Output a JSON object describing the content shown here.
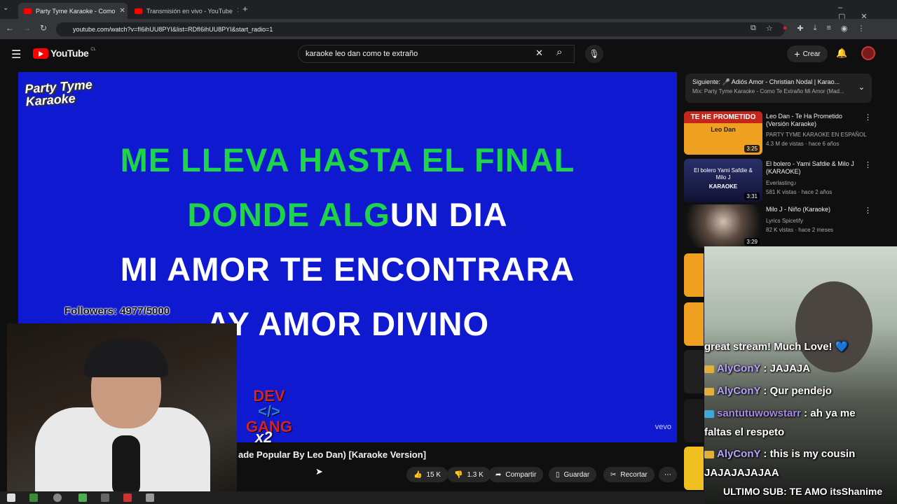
{
  "browser": {
    "tabs": [
      {
        "title": "Party Tyme Karaoke - Como",
        "active": true
      },
      {
        "title": "Transmisión en vivo - YouTube",
        "active": false
      }
    ],
    "url": "youtube.com/watch?v=fI6ihUU8PYI&list=RDfI6ihUU8PYI&start_radio=1"
  },
  "youtube": {
    "logo": "YouTube",
    "region": "CL",
    "search_query": "karaoke leo dan como te extraño",
    "create_label": "Crear"
  },
  "player": {
    "brand": "Party Tyme Karaoke",
    "lyrics": {
      "line1": "ME LLEVA HASTA EL FINAL",
      "line2_sung": "DONDE ALG",
      "line2_rest": "UN DIA",
      "line3": "MI AMOR TE ENCONTRARA",
      "line4": "AY AMOR DIVINO"
    },
    "vevo": "vevo"
  },
  "overlay": {
    "followers": "Followers: 4977/5000",
    "devgang_top": "DEV",
    "devgang_mid": "</>",
    "devgang_bottom": "GANG",
    "devgang_multiplier": "x2",
    "ultimo_sub": "ULTIMO SUB: TE AMO itsShanime"
  },
  "video": {
    "title": "ade Popular By Leo Dan) [Karaoke Version]",
    "likes": "15 K",
    "dislikes": "1.3 K",
    "share": "Compartir",
    "save": "Guardar",
    "clip": "Recortar"
  },
  "up_next": {
    "label": "Siguiente:",
    "next_title": "🎤 Adiós Amor - Christian Nodal | Karao...",
    "mix": "Mix: Party Tyme Karaoke - Como Te Extraño Mi Amor (Mad..."
  },
  "recommendations": [
    {
      "title": "Leo Dan - Te Ha Prometido (Versión Karaoke)",
      "channel": "PARTY TYME KARAOKE EN ESPAÑOL",
      "meta": "4.3 M de vistas · hace 6 años",
      "duration": "3:25",
      "thumb_text1": "TE HE PROMETIDO",
      "thumb_text2": "Leo Dan"
    },
    {
      "title": "El bolero - Yami Safdie & Milo J (KARAOKE)",
      "channel": "Everlasting♪",
      "meta": "581 K vistas · hace 2 años",
      "duration": "3:31",
      "thumb_text1": "El bolero Yami Safdie & Milo J",
      "thumb_text2": "KARAOKE"
    },
    {
      "title": "Milo J - Niño (Karaoke)",
      "channel": "Lyrics Spicetify",
      "meta": "82 K vistas · hace 2 meses",
      "duration": "3:29"
    }
  ],
  "chat": [
    {
      "user": "",
      "message": "great stream! Much Love! 💙"
    },
    {
      "user": "AlyConY",
      "message": " : JAJAJA"
    },
    {
      "user": "AlyConY",
      "message": " : Qur pendejo"
    },
    {
      "user": "santutuwowstarr",
      "message": " : ah ya me",
      "cont": "faltas el respeto"
    },
    {
      "user": "AlyConY",
      "message": " : this is my cousin",
      "cont": "JAJAJAJAJAA"
    }
  ],
  "colors": {
    "player_bg": "#0f19d0",
    "lyric_sung": "#1ed44a",
    "youtube_red": "#ff0000"
  }
}
